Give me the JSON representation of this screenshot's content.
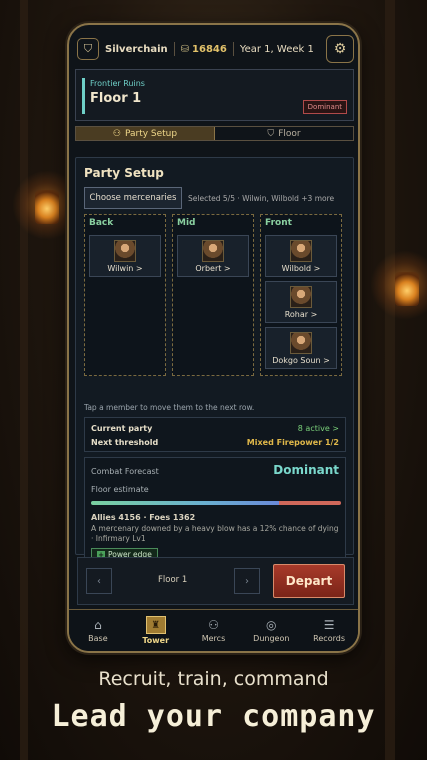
{
  "topbar": {
    "name": "Silverchain",
    "gold": "16846",
    "date": "Year 1, Week 1"
  },
  "floor_card": {
    "subtitle": "Frontier Ruins",
    "title": "Floor 1",
    "badge": "Dominant"
  },
  "tabs": [
    {
      "label": "Party Setup"
    },
    {
      "label": "Floor"
    }
  ],
  "party": {
    "title": "Party Setup",
    "choose_label": "Choose mercenaries",
    "selected_text": "Selected 5/5 · Wilwin, Wilbold +3 more",
    "rows": [
      {
        "label": "Back",
        "members": [
          "Wilwin >"
        ]
      },
      {
        "label": "Mid",
        "members": [
          "Orbert >"
        ]
      },
      {
        "label": "Front",
        "members": [
          "Wilbold >",
          "Rohar >",
          "Dokgo Soun >"
        ]
      }
    ],
    "hint": "Tap a member to move them to the next row.",
    "current_party_label": "Current party",
    "current_party_value": "8 active >",
    "next_threshold_label": "Next threshold",
    "next_threshold_value": "Mixed Firepower 1/2"
  },
  "forecast": {
    "title": "Combat Forecast",
    "verdict": "Dominant",
    "estimate_label": "Floor estimate",
    "allies_foes": "Allies 4156 · Foes 1362",
    "allies": 4156,
    "foes": 1362,
    "note": "A mercenary downed by a heavy blow has a 12% chance of dying · Infirmary Lv1",
    "edge_label": "Power edge"
  },
  "depart_bar": {
    "floor": "Floor 1",
    "depart_label": "Depart"
  },
  "nav": [
    {
      "label": "Base",
      "icon": "home-icon"
    },
    {
      "label": "Tower",
      "icon": "tower-icon"
    },
    {
      "label": "Mercs",
      "icon": "people-icon"
    },
    {
      "label": "Dungeon",
      "icon": "compass-icon"
    },
    {
      "label": "Records",
      "icon": "scroll-icon"
    }
  ],
  "tagline": "Recruit, train, command",
  "headline": "Lead your company",
  "colors": {
    "accent_gold": "#e2c26a",
    "teal": "#6fd0c8",
    "depart": "#a83a2a"
  }
}
